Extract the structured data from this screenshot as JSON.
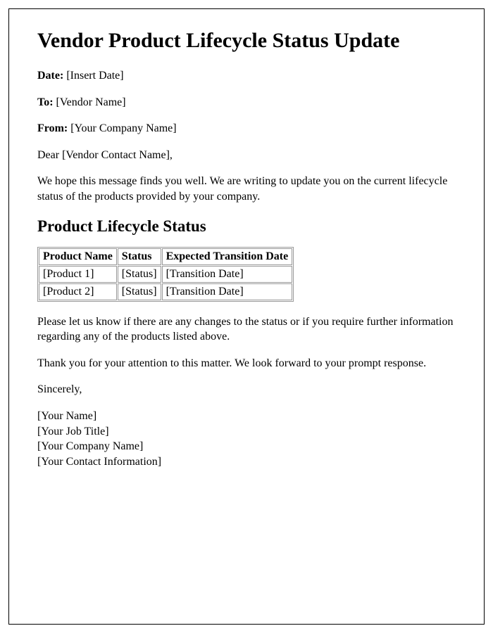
{
  "title": "Vendor Product Lifecycle Status Update",
  "fields": {
    "date_label": "Date:",
    "date_value": " [Insert Date]",
    "to_label": "To:",
    "to_value": " [Vendor Name]",
    "from_label": "From:",
    "from_value": " [Your Company Name]"
  },
  "salutation": "Dear [Vendor Contact Name],",
  "intro": "We hope this message finds you well. We are writing to update you on the current lifecycle status of the products provided by your company.",
  "section_heading": "Product Lifecycle Status",
  "table": {
    "headers": {
      "col1": "Product Name",
      "col2": "Status",
      "col3": "Expected Transition Date"
    },
    "rows": [
      {
        "name": "[Product 1]",
        "status": "[Status]",
        "date": "[Transition Date]"
      },
      {
        "name": "[Product 2]",
        "status": "[Status]",
        "date": "[Transition Date]"
      }
    ]
  },
  "body2": "Please let us know if there are any changes to the status or if you require further information regarding any of the products listed above.",
  "body3": "Thank you for your attention to this matter. We look forward to your prompt response.",
  "closing": "Sincerely,",
  "signature": {
    "name": "[Your Name]",
    "title": "[Your Job Title]",
    "company": "[Your Company Name]",
    "contact": "[Your Contact Information]"
  }
}
